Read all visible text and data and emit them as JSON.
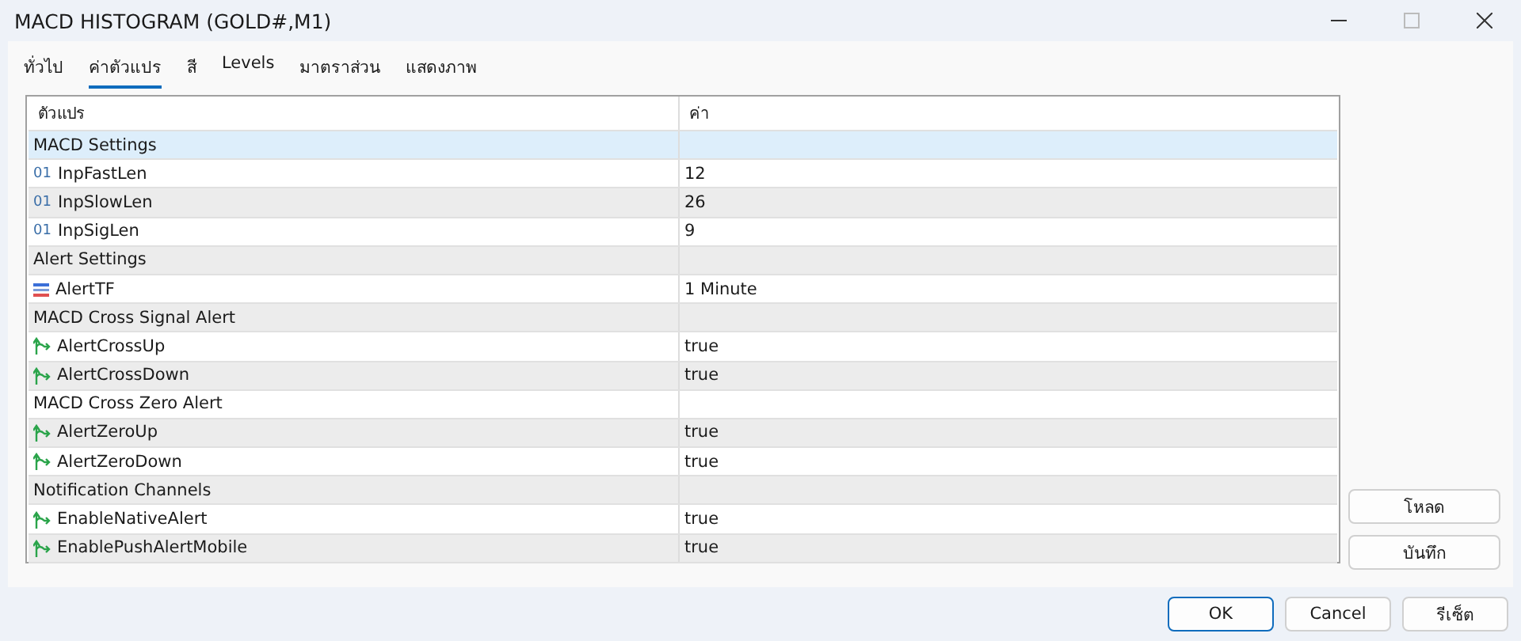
{
  "window": {
    "title": "MACD HISTOGRAM (GOLD#,M1)"
  },
  "tabs": [
    {
      "label": "ทั่วไป",
      "selected": false
    },
    {
      "label": "ค่าตัวแปร",
      "selected": true
    },
    {
      "label": "สี",
      "selected": false
    },
    {
      "label": "Levels",
      "selected": false
    },
    {
      "label": "มาตราส่วน",
      "selected": false
    },
    {
      "label": "แสดงภาพ",
      "selected": false
    }
  ],
  "table": {
    "columns": [
      "ตัวแปร",
      "ค่า"
    ],
    "rows": [
      {
        "kind": "group",
        "name": "MACD Settings",
        "selected": true
      },
      {
        "kind": "int",
        "icon": "01",
        "name": "InpFastLen",
        "value": "12",
        "selected": false
      },
      {
        "kind": "int",
        "icon": "01",
        "name": "InpSlowLen",
        "value": "26",
        "selected": false
      },
      {
        "kind": "int",
        "icon": "01",
        "name": "InpSigLen",
        "value": "9",
        "selected": false
      },
      {
        "kind": "group",
        "name": "Alert Settings",
        "selected": false
      },
      {
        "kind": "enum",
        "name": "AlertTF",
        "value": "1 Minute",
        "selected": false
      },
      {
        "kind": "group",
        "name": "MACD Cross Signal Alert",
        "selected": false
      },
      {
        "kind": "bool",
        "name": "AlertCrossUp",
        "value": "true",
        "selected": false
      },
      {
        "kind": "bool",
        "name": "AlertCrossDown",
        "value": "true",
        "selected": false
      },
      {
        "kind": "group",
        "name": "MACD Cross Zero Alert",
        "selected": false
      },
      {
        "kind": "bool",
        "name": "AlertZeroUp",
        "value": "true",
        "selected": false
      },
      {
        "kind": "bool",
        "name": "AlertZeroDown",
        "value": "true",
        "selected": false
      },
      {
        "kind": "group",
        "name": "Notification Channels",
        "selected": false
      },
      {
        "kind": "bool",
        "name": "EnableNativeAlert",
        "value": "true",
        "selected": false
      },
      {
        "kind": "bool",
        "name": "EnablePushAlertMobile",
        "value": "true",
        "selected": false
      }
    ]
  },
  "side_buttons": [
    "โหลด",
    "บันทึก"
  ],
  "buttons": [
    {
      "label": "OK",
      "default": true
    },
    {
      "label": "Cancel",
      "default": false
    },
    {
      "label": "รีเซ็ต",
      "default": false
    }
  ]
}
